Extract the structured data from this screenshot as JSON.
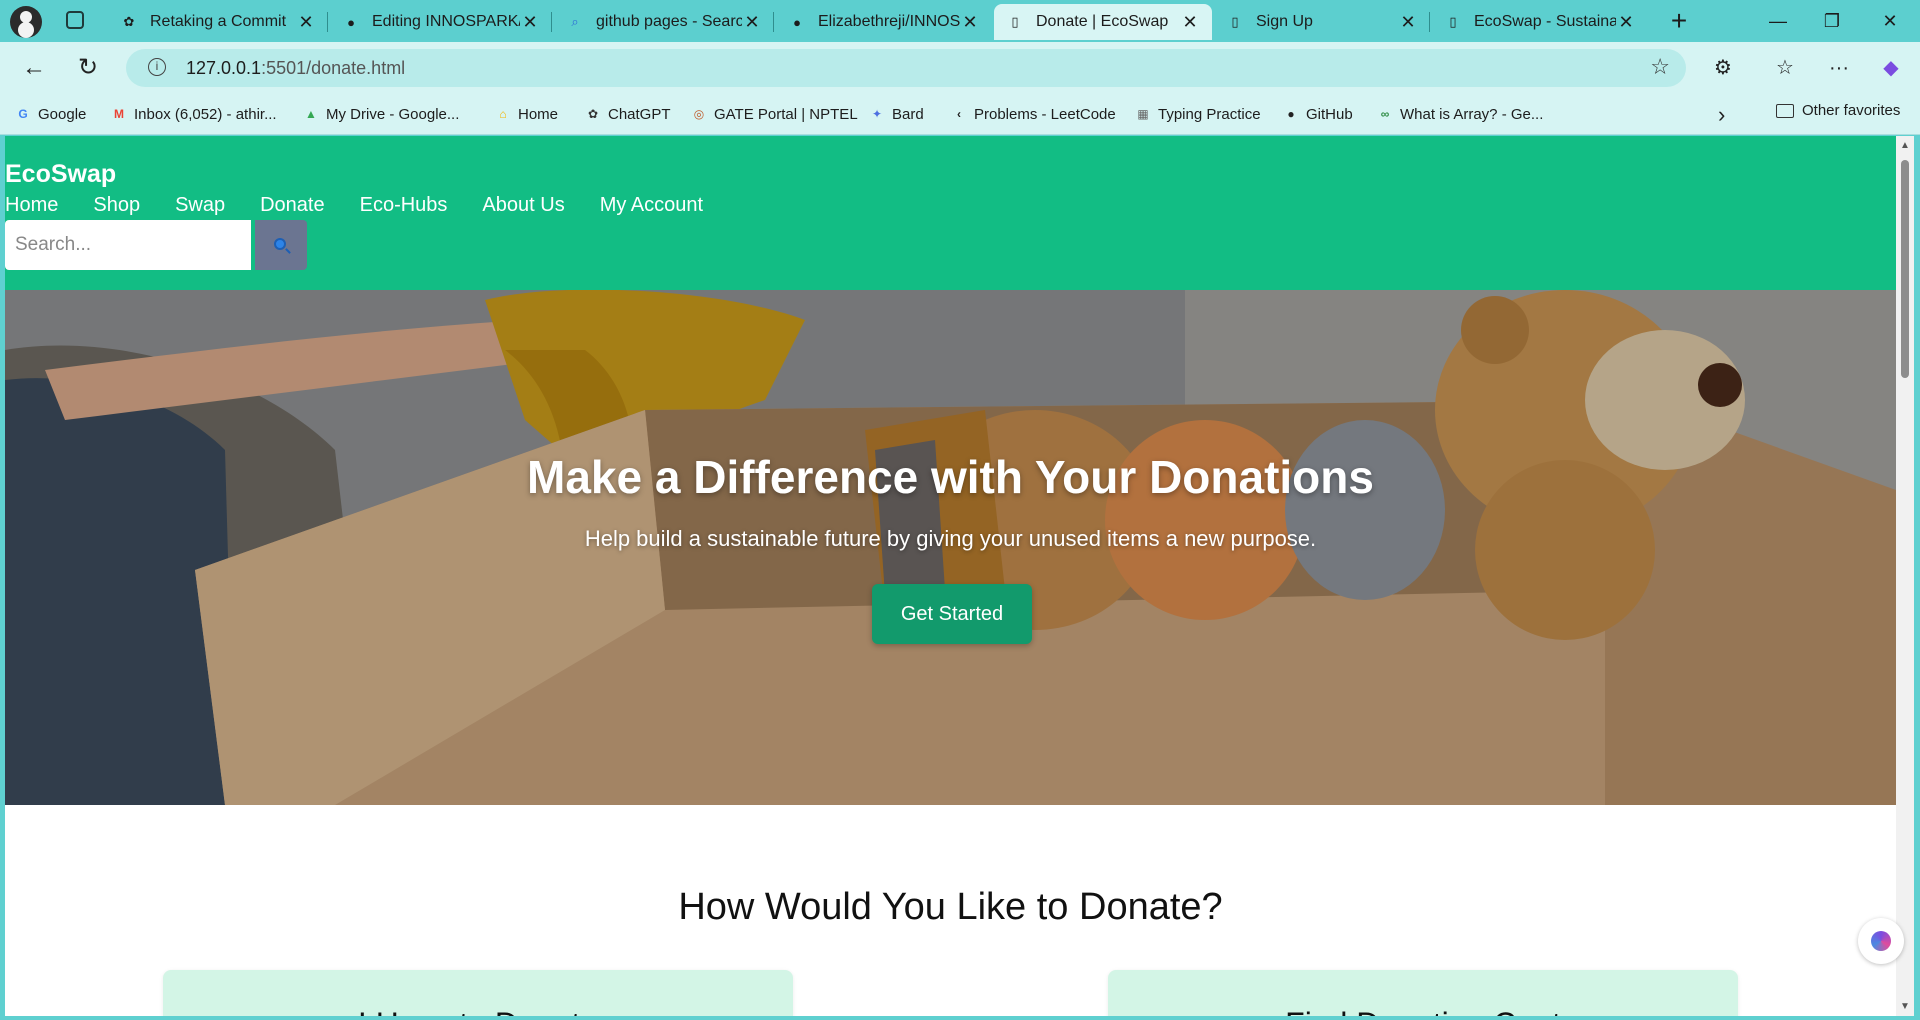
{
  "browser": {
    "tabs": [
      {
        "title": "Retaking a Commit",
        "icon": "chatgpt-icon",
        "active": false
      },
      {
        "title": "Editing INNOSPARK/R",
        "icon": "github-icon",
        "active": false
      },
      {
        "title": "github pages - Search",
        "icon": "search-icon",
        "active": false
      },
      {
        "title": "Elizabethreji/INNOSPA",
        "icon": "github-icon",
        "active": false
      },
      {
        "title": "Donate | EcoSwap",
        "icon": "page-icon",
        "active": true
      },
      {
        "title": "Sign Up",
        "icon": "page-icon",
        "active": false
      },
      {
        "title": "EcoSwap - Sustainable",
        "icon": "page-icon",
        "active": false
      }
    ],
    "close_glyph": "✕",
    "new_tab_glyph": "+",
    "window_controls": {
      "minimize": "—",
      "restore": "❐",
      "close": "✕"
    },
    "address": {
      "host": "127.0.0.1",
      "path": ":5501/donate.html"
    },
    "nav": {
      "back": "←",
      "reload": "↻",
      "star": "☆"
    },
    "toolbar_icons": {
      "extensions": "⚙",
      "favorites": "☆",
      "menu": "···",
      "copilot": "◆"
    },
    "bookmarks": [
      {
        "label": "Google",
        "icon": "google-icon",
        "glyph": "G",
        "color": "#4285f4"
      },
      {
        "label": "Inbox (6,052) - athir...",
        "icon": "gmail-icon",
        "glyph": "M",
        "color": "#ea4335"
      },
      {
        "label": "My Drive - Google...",
        "icon": "drive-icon",
        "glyph": "▲",
        "color": "#34a853"
      },
      {
        "label": "Home",
        "icon": "home-icon",
        "glyph": "⌂",
        "color": "#f4b400"
      },
      {
        "label": "ChatGPT",
        "icon": "chatgpt-icon",
        "glyph": "✿",
        "color": "#333333"
      },
      {
        "label": "GATE Portal | NPTEL",
        "icon": "nptel-icon",
        "glyph": "◎",
        "color": "#c05a2a"
      },
      {
        "label": "Bard",
        "icon": "bard-icon",
        "glyph": "✦",
        "color": "#4c6fe0"
      },
      {
        "label": "Problems - LeetCode",
        "icon": "leetcode-icon",
        "glyph": "‹",
        "color": "#222222"
      },
      {
        "label": "Typing Practice",
        "icon": "typing-icon",
        "glyph": "▦",
        "color": "#666666"
      },
      {
        "label": "GitHub",
        "icon": "github-icon",
        "glyph": "●",
        "color": "#222222"
      },
      {
        "label": "What is Array? - Ge...",
        "icon": "geeksforgeeks-icon",
        "glyph": "∞",
        "color": "#2f8d46"
      }
    ],
    "bookmarks_more": "›",
    "other_favorites": "Other favorites"
  },
  "site": {
    "logo": "EcoSwap",
    "nav": [
      "Home",
      "Shop",
      "Swap",
      "Donate",
      "Eco-Hubs",
      "About Us",
      "My Account"
    ],
    "search_placeholder": "Search...",
    "hero": {
      "title": "Make a Difference with Your Donations",
      "subtitle": "Help build a sustainable future by giving your unused items a new purpose.",
      "button": "Get Started"
    },
    "section_title": "How Would You Like to Donate?",
    "cards": [
      {
        "title": "I Have to Donate"
      },
      {
        "title": "Find Donation Cent"
      }
    ]
  },
  "colors": {
    "header_green": "#12bd84",
    "button_green": "#129a6c",
    "card_mint": "#d3f5e6",
    "browser_teal": "#5ccfcf"
  }
}
